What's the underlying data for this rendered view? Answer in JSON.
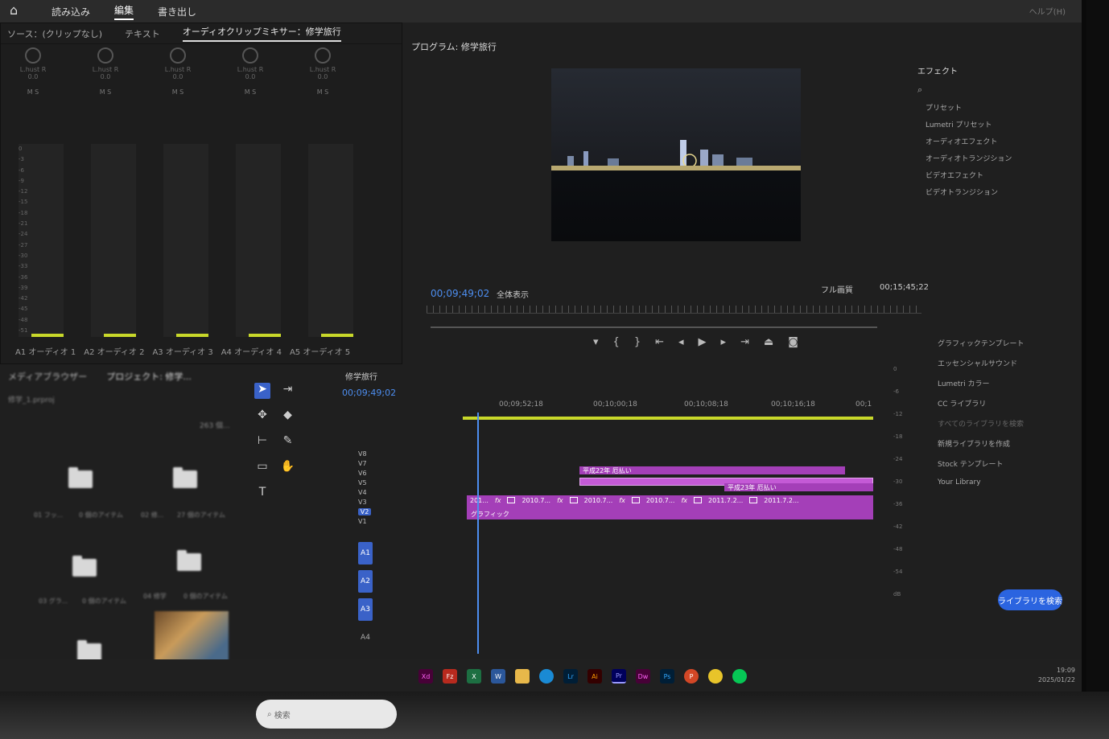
{
  "titlebar": {
    "workspaces": [
      "読み込み",
      "編集",
      "書き出し"
    ],
    "active_workspace": "編集",
    "menu_right": "ヘルプ(H)"
  },
  "top_tabs": [
    {
      "label": "ソース：(クリップなし)",
      "active": false
    },
    {
      "label": "テキスト",
      "active": false
    },
    {
      "label": "オーディオクリップミキサー：修学旅行",
      "active": true
    }
  ],
  "mixer": {
    "strips": [
      {
        "label": "L.hust R",
        "value": "0.0"
      },
      {
        "label": "L.hust R",
        "value": "0.0"
      },
      {
        "label": "L.hust R",
        "value": "0.0"
      },
      {
        "label": "L.hust R",
        "value": "0.0"
      },
      {
        "label": "L.hust R",
        "value": "0.0"
      }
    ],
    "ms_label": "M S",
    "scale": [
      "0",
      "-3",
      "-6",
      "-9",
      "-12",
      "-15",
      "-18",
      "-21",
      "-24",
      "-27",
      "-30",
      "-33",
      "-36",
      "-39",
      "-42",
      "-45",
      "-48",
      "-51"
    ],
    "track_names": [
      "A1 オーディオ 1",
      "A2 オーディオ 2",
      "A3 オーディオ 3",
      "A4 オーディオ 4",
      "A5 オーディオ 5"
    ]
  },
  "program_monitor": {
    "title": "プログラム: 修学旅行",
    "current_timecode": "00;09;49;02",
    "zoom": "全体表示",
    "quality": "フル画質",
    "duration": "00;15;45;22"
  },
  "effects_panel": {
    "title": "エフェクト",
    "items": [
      "プリセット",
      "Lumetri プリセット",
      "オーディオエフェクト",
      "オーディオトランジション",
      "ビデオエフェクト",
      "ビデオトランジション"
    ]
  },
  "libraries_panel": {
    "items": [
      "グラフィックテンプレート",
      "エッセンシャルサウンド",
      "Lumetri カラー",
      "CC ライブラリ"
    ],
    "search_placeholder": "すべてのライブラリを検索",
    "create_new": "新規ライブラリを作成",
    "stock": "Stock テンプレート",
    "your_library": "Your Library",
    "button": "ライブラリを検索"
  },
  "project_panel": {
    "tabs": [
      "メディアブラウザー",
      "プロジェクト: 修学..."
    ],
    "file": "修学_1.prproj",
    "count": "263 個...",
    "items": [
      {
        "label": "01 フッ...",
        "count": "0 個のアイテム"
      },
      {
        "label": "02 修...",
        "count": "27 個のアイテム"
      },
      {
        "label": "03 グラ...",
        "count": "0 個のアイテム"
      },
      {
        "label": "04 修学",
        "count": "0 個のアイテム"
      }
    ]
  },
  "timeline": {
    "title": "修学旅行",
    "timecode": "00;09;49;02",
    "ruler": [
      "00;09;52;18",
      "00;10;00;18",
      "00;10;08;18",
      "00;10;16;18",
      "00;1"
    ],
    "video_tracks": [
      "V8",
      "V7",
      "V6",
      "V5",
      "V4",
      "V3",
      "V2",
      "V1"
    ],
    "audio_tracks": [
      "A1",
      "A2",
      "A3",
      "A4"
    ],
    "clips": {
      "title1": "平成22年 厄払い",
      "title2": "平成23年 厄払い",
      "v1_a": "201...",
      "v1_b": "2010.7...",
      "v1_c": "2010.7...",
      "v1_d": "2010.7...",
      "v1_e": "2011.7.2...",
      "v1_f": "2011.7.2...",
      "v1_label": "グラフィック"
    },
    "level_scale": [
      "0",
      "-6",
      "-12",
      "-18",
      "-24",
      "-30",
      "-36",
      "-42",
      "-48",
      "-54",
      "dB"
    ]
  },
  "taskbar": {
    "search": "検索",
    "apps": [
      "Xd",
      "Fz",
      "X",
      "W",
      "Lr",
      "Ai",
      "Pr",
      "Dw",
      "Ps",
      "P"
    ],
    "time": "19:09",
    "date": "2025/01/22"
  },
  "colors": {
    "accent": "#4d8ef0",
    "clip": "#a43fb8",
    "meter": "#c8d82a"
  }
}
